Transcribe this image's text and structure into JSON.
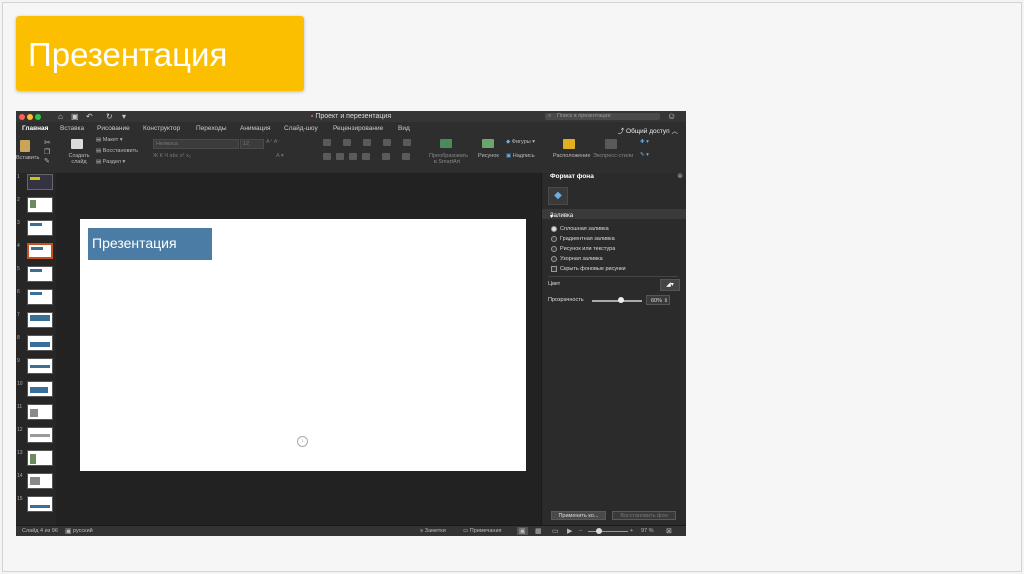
{
  "slide_heading": "Презентация",
  "window": {
    "title": "Проект и перезентация",
    "search_placeholder": "Поиск в презентации"
  },
  "menu": {
    "tabs": [
      "Главная",
      "Вставка",
      "Рисование",
      "Конструктор",
      "Переходы",
      "Анимация",
      "Слайд-шоу",
      "Рецензирование",
      "Вид"
    ],
    "share": "Общий доступ"
  },
  "ribbon": {
    "paste": "Вставить",
    "new_slide": "Создать слайд",
    "layout": "Макет",
    "reset": "Восстановить",
    "section": "Раздел",
    "font_name": "Нелвоса",
    "font_size": "12",
    "convert_smartart": "Преобразовать в SmartArt",
    "picture": "Рисунок",
    "shapes": "Фигуры",
    "textbox": "Надпись",
    "arrange": "Расположение",
    "quick_styles": "Экспресс-стили"
  },
  "thumbnails": [
    "1",
    "2",
    "3",
    "4",
    "5",
    "6",
    "7",
    "8",
    "9",
    "10",
    "11",
    "12",
    "13",
    "14",
    "15"
  ],
  "slide": {
    "title": "Презентация"
  },
  "format_pane": {
    "title": "Формат фона",
    "section": "Заливка",
    "fill_options": [
      "Сплошная заливка",
      "Градиентная заливка",
      "Рисунок или текстура",
      "Узорная заливка"
    ],
    "hide_bg": "Скрыть фоновые рисунки",
    "color_label": "Цвет",
    "transparency_label": "Прозрачность",
    "transparency_value": "60%",
    "transparency": 0.6,
    "apply_button": "Применить ко...",
    "reset_button": "Восстановить фон"
  },
  "status": {
    "slide_counter": "Слайд 4 из 96",
    "language": "русский",
    "notes": "Заметки",
    "comments": "Примечания",
    "zoom": "97 %"
  }
}
